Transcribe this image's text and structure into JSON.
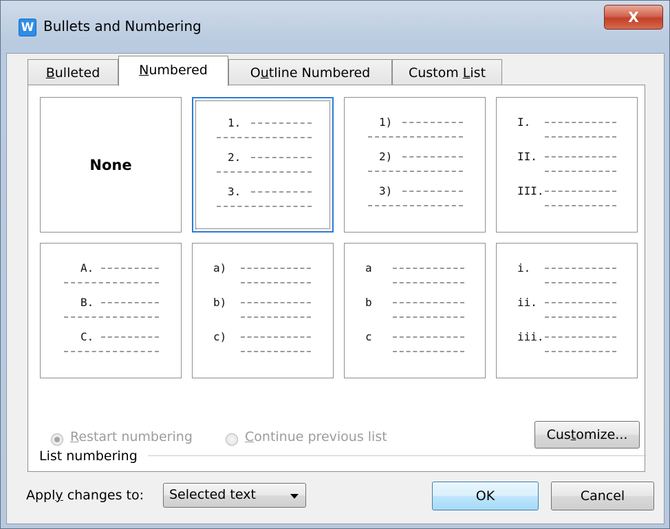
{
  "window": {
    "title": "Bullets and Numbering",
    "app_icon_glyph": "W",
    "close_glyph": "X"
  },
  "tabs": [
    {
      "label_pre": "",
      "label_key": "B",
      "label_post": "ulleted",
      "active": false
    },
    {
      "label_pre": "",
      "label_key": "N",
      "label_post": "umbered",
      "active": true
    },
    {
      "label_pre": "O",
      "label_key": "u",
      "label_post": "tline Numbered",
      "active": false
    },
    {
      "label_pre": "Custom ",
      "label_key": "L",
      "label_post": "ist",
      "active": false
    }
  ],
  "styles": {
    "none_label": "None",
    "tile_2": [
      "1.",
      "2.",
      "3."
    ],
    "tile_3": [
      "1)",
      "2)",
      "3)"
    ],
    "tile_4": [
      "I.",
      "II.",
      "III."
    ],
    "tile_5": [
      "A.",
      "B.",
      "C."
    ],
    "tile_6": [
      "a)",
      "b)",
      "c)"
    ],
    "tile_7": [
      "a",
      "b",
      "c"
    ],
    "tile_8": [
      "i.",
      "ii.",
      "iii."
    ],
    "selected_tile": 2
  },
  "list_numbering": {
    "group_label": "List numbering",
    "restart": {
      "pre": "",
      "key": "R",
      "post": "estart numbering",
      "checked": true
    },
    "continue": {
      "pre": "",
      "key": "C",
      "post": "ontinue previous list",
      "checked": false
    },
    "customize": {
      "pre": "Cus",
      "key": "t",
      "post": "omize..."
    }
  },
  "footer": {
    "apply_pre": "Appl",
    "apply_key": "y",
    "apply_post": " changes to:",
    "apply_value": "Selected text",
    "ok_label": "OK",
    "cancel_label": "Cancel"
  },
  "colors": {
    "selection_border": "#2b7bd6",
    "disabled_text": "#9c9c9c",
    "close_button": "#c2402a"
  }
}
